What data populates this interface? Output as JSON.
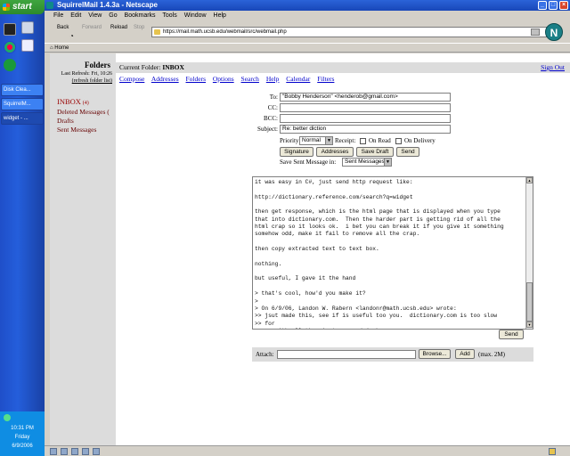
{
  "taskbar": {
    "start_label": "start",
    "quick_launch": [
      "command-prompt",
      "firefox",
      "editor",
      "accessibility"
    ],
    "tasks": [
      {
        "label": "Disk Clea..."
      },
      {
        "label": "SquirrelM..."
      },
      {
        "label": "widget - ..."
      }
    ],
    "clock": {
      "time": "10:31 PM",
      "day": "Friday",
      "date": "6/9/2006"
    }
  },
  "browser": {
    "title": "SquirrelMail 1.4.3a - Netscape",
    "menu": [
      "File",
      "Edit",
      "View",
      "Go",
      "Bookmarks",
      "Tools",
      "Window",
      "Help"
    ],
    "nav": {
      "back": "Back",
      "forward": "Forward",
      "reload": "Reload",
      "stop": "Stop"
    },
    "url": "https://mail.math.ucsb.edu/webmail/src/webmail.php",
    "bookmark_home": "Home",
    "logo": "N"
  },
  "sidebar": {
    "title": "Folders",
    "last_refresh": "Last Refresh: Fri, 10:26",
    "refresh_link": "(refresh folder list)",
    "folders": [
      {
        "label": "INBOX",
        "count": "(4)"
      },
      {
        "label": "Deleted Messages",
        "count": "("
      },
      {
        "label": "Drafts",
        "count": ""
      },
      {
        "label": "Sent Messages",
        "count": ""
      }
    ]
  },
  "main": {
    "current_folder_label": "Current Folder:",
    "current_folder": "INBOX",
    "sign_out": "Sign Out",
    "links": [
      "Compose",
      "Addresses",
      "Folders",
      "Options",
      "Search",
      "Help",
      "Calendar",
      "Filters"
    ]
  },
  "compose": {
    "to_label": "To:",
    "to_value": "\"Bobby Henderson\" <henderob@gmail.com>",
    "cc_label": "CC:",
    "cc_value": "",
    "bcc_label": "BCC:",
    "bcc_value": "",
    "subject_label": "Subject:",
    "subject_value": "Re: better diction",
    "priority_label": "Priority:",
    "priority_value": "Normal",
    "receipt_label": "Receipt:",
    "on_read_label": "On Read",
    "on_delivery_label": "On Delivery",
    "buttons": {
      "signature": "Signature",
      "addresses": "Addresses",
      "save_draft": "Save Draft",
      "send": "Send"
    },
    "save_sent_label": "Save Sent Message in:",
    "save_sent_value": "Sent Messages",
    "body": "it was easy in C#, just send http request like:\n\nhttp://dictionary.reference.com/search?q=widget\n\nthen get response, which is the html page that is displayed when you type\nthat into dictionary.com.  Then the harder part is getting rid of all the\nhtml crap so it looks ok.  i bet you can break it if you give it something\nsomehow odd, make it fail to remove all the crap.\n\nthen copy extracted text to text box.\n\nnothing.\n\nbut useful, I gave it the hand\n\n> that's cool, how'd you make it?\n>\n> On 6/9/06, Landon W. Rabern <landonr@math.ucsb.edu> wrote:\n>> jsut made this, see if is useful too you.  dictionary.com is too slow\n>> for\n>> me with all the picstures and junk.",
    "send_bottom": "Send",
    "attach_label": "Attach:",
    "browse_label": "Browse...",
    "add_label": "Add",
    "max_label": "(max. 2M)"
  }
}
